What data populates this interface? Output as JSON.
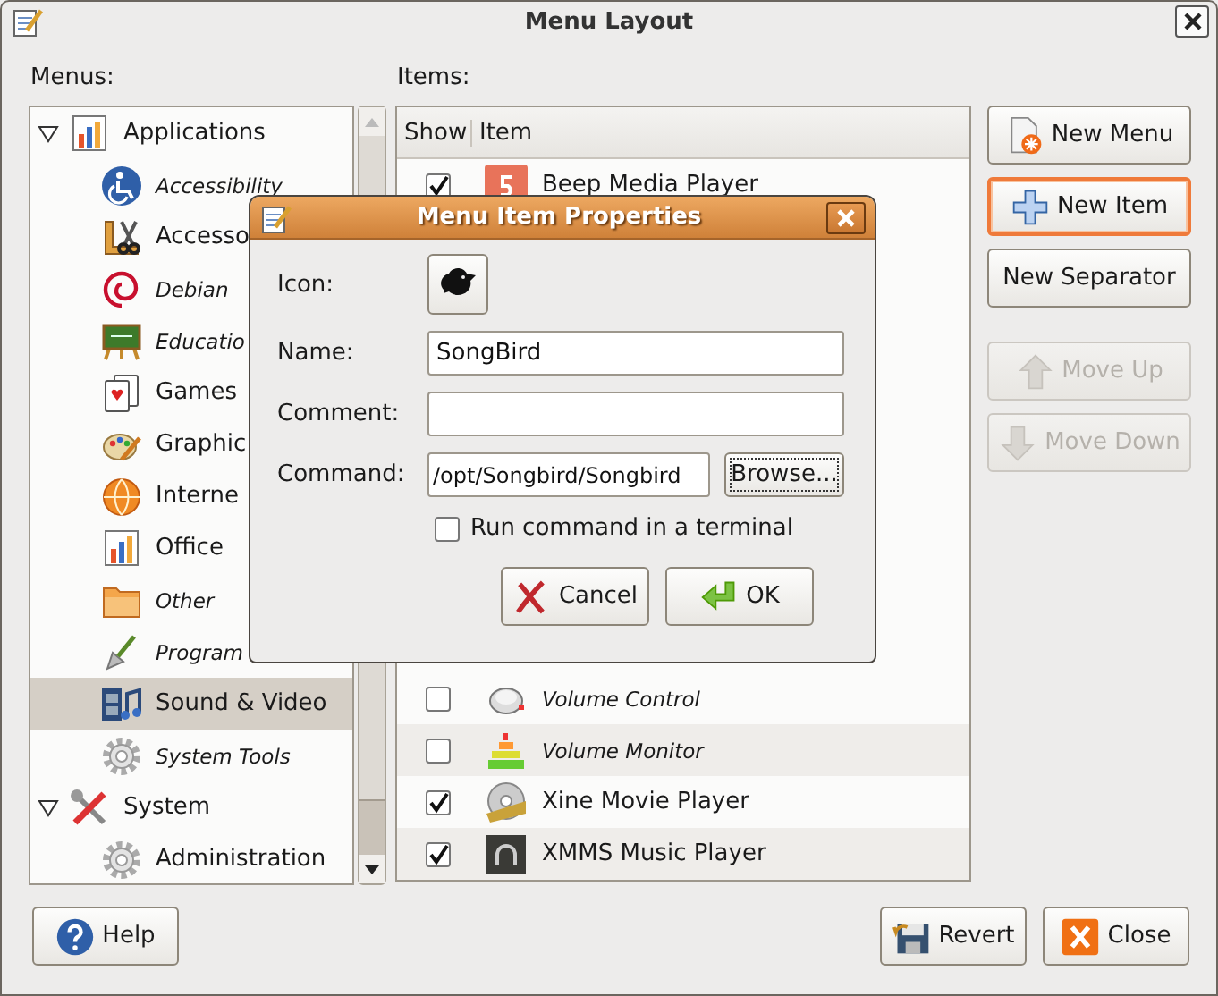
{
  "window": {
    "title": "Menu Layout"
  },
  "menus_label": "Menus:",
  "menus": [
    {
      "label": "Applications",
      "expanded": true,
      "selected": false,
      "shown": true,
      "children": [
        {
          "label": "Accessibility",
          "selected": false,
          "shown": false
        },
        {
          "label": "Accesso",
          "selected": false,
          "shown": true
        },
        {
          "label": "Debian",
          "selected": false,
          "shown": false
        },
        {
          "label": "Educatio",
          "selected": false,
          "shown": false
        },
        {
          "label": "Games",
          "selected": false,
          "shown": true
        },
        {
          "label": "Graphic",
          "selected": false,
          "shown": true
        },
        {
          "label": "Interne",
          "selected": false,
          "shown": true
        },
        {
          "label": "Office",
          "selected": false,
          "shown": true
        },
        {
          "label": "Other",
          "selected": false,
          "shown": false
        },
        {
          "label": "Program",
          "selected": false,
          "shown": false
        },
        {
          "label": "Sound & Video",
          "selected": true,
          "shown": true
        },
        {
          "label": "System Tools",
          "selected": false,
          "shown": false
        }
      ]
    },
    {
      "label": "System",
      "expanded": true,
      "selected": false,
      "shown": true,
      "children": [
        {
          "label": "Administration",
          "selected": false,
          "shown": true
        }
      ]
    }
  ],
  "items_label": "Items:",
  "items_columns": [
    "Show",
    "Item"
  ],
  "items": [
    {
      "label": "Beep Media Player",
      "show": true
    },
    {
      "label": "Volume Control",
      "show": false
    },
    {
      "label": "Volume Monitor",
      "show": false
    },
    {
      "label": "Xine Movie Player",
      "show": true
    },
    {
      "label": "XMMS Music Player",
      "show": true
    }
  ],
  "item_buttons": [
    {
      "label": "New Menu",
      "disabled": false,
      "focused": false
    },
    {
      "label": "New Item",
      "disabled": false,
      "focused": true
    },
    {
      "label": "New Separator",
      "disabled": false,
      "focused": false
    }
  ],
  "move_buttons": [
    {
      "label": "Move Up",
      "disabled": true
    },
    {
      "label": "Move Down",
      "disabled": true
    }
  ],
  "help_button": {
    "label": "Help"
  },
  "action_buttons": [
    {
      "label": "Revert"
    },
    {
      "label": "Close"
    }
  ],
  "dialog": {
    "title": "Menu Item Properties",
    "icon_label": "Icon:",
    "fields": [
      {
        "label": "Name:",
        "value": "SongBird"
      },
      {
        "label": "Comment:"
      },
      {
        "label": "Command:",
        "value": "/opt/Songbird/Songbird",
        "button": {
          "label": "Browse...",
          "focused": true
        }
      }
    ],
    "terminal": {
      "label": "Run command in a terminal",
      "checked": false
    },
    "buttons": [
      {
        "label": "Cancel"
      },
      {
        "label": "OK"
      }
    ]
  }
}
